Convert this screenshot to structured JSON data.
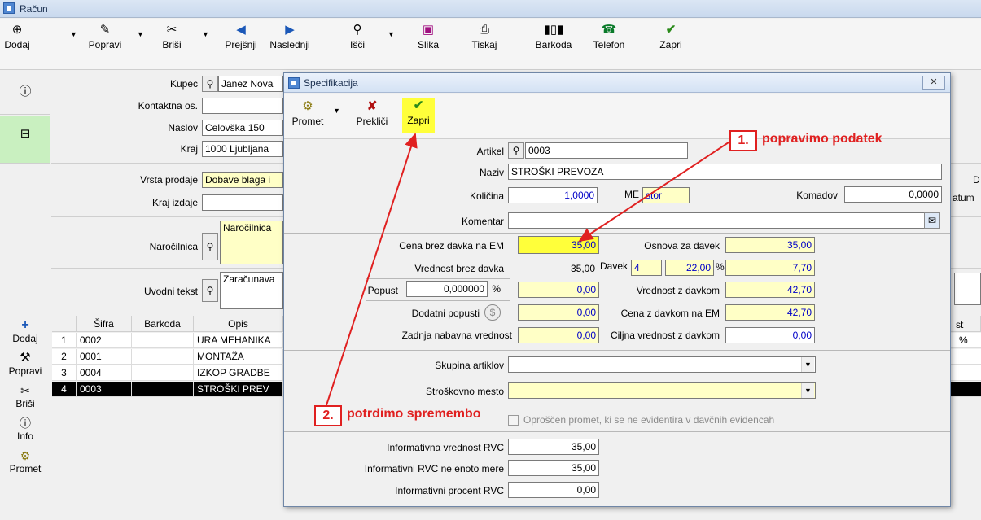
{
  "window": {
    "title": "Račun"
  },
  "toolbar": {
    "items": [
      "Dodaj",
      "Popravi",
      "Briši",
      "Prejšnji",
      "Naslednji",
      "Išči",
      "Slika",
      "Tiskaj",
      "Barkoda",
      "Telefon",
      "Zapri"
    ]
  },
  "sidebar": {
    "buttons": [
      "Dodaj",
      "Popravi",
      "Briši",
      "Info",
      "Promet"
    ]
  },
  "form": {
    "kupec_label": "Kupec",
    "kupec": "Janez Nova",
    "kontakt_label": "Kontaktna os.",
    "kontakt": "",
    "naslov_label": "Naslov",
    "naslov": "Celovška 150",
    "kraj_label": "Kraj",
    "kraj": "1000 Ljubljana",
    "vrsta_label": "Vrsta prodaje",
    "vrsta": "Dobave blaga i",
    "krajizd_label": "Kraj izdaje",
    "krajizd": "",
    "narocilnica_label": "Naročilnica",
    "narocilnica": "Naročilnica",
    "uvodni_label": "Uvodni tekst",
    "uvodni": "Zaračunava",
    "right_d": "D",
    "right_datum": "atum",
    "right_st": "st",
    "right_pct": "%"
  },
  "grid": {
    "headers": [
      "Šifra",
      "Barkoda",
      "Opis"
    ],
    "rows": [
      {
        "n": "1",
        "sifra": "0002",
        "opis": "URA MEHANIKA"
      },
      {
        "n": "2",
        "sifra": "0001",
        "opis": "MONTAŽA"
      },
      {
        "n": "3",
        "sifra": "0004",
        "opis": "IZKOP GRADBE"
      },
      {
        "n": "4",
        "sifra": "0003",
        "opis": "STROŠKI PREV"
      }
    ]
  },
  "dialog": {
    "title": "Specifikacija",
    "toolbar": [
      "Promet",
      "Prekliči",
      "Zapri"
    ],
    "artikel_label": "Artikel",
    "artikel": "0003",
    "naziv_label": "Naziv",
    "naziv": "STROŠKI PREVOZA",
    "kolicina_label": "Količina",
    "kolicina": "1,0000",
    "me_label": "ME",
    "me": "stor",
    "komadov_label": "Komadov",
    "komadov": "0,0000",
    "komentar_label": "Komentar",
    "komentar": "",
    "cena_label": "Cena brez davka na EM",
    "cena": "35,00",
    "osnova_label": "Osnova za davek",
    "osnova": "35,00",
    "vrednost_label": "Vrednost brez davka",
    "vrednost": "35,00",
    "davek_label": "Davek",
    "davek_code": "4",
    "davek_rate": "22,00",
    "pct": "%",
    "davek_val": "7,70",
    "popust_label": "Popust",
    "popust": "0,000000",
    "popust_val": "0,00",
    "vrednostz_label": "Vrednost z davkom",
    "vrednostz": "42,70",
    "dodatni_label": "Dodatni popusti",
    "dodatni": "0,00",
    "cenaz_label": "Cena z davkom na EM",
    "cenaz": "42,70",
    "zadnja_label": "Zadnja nabavna vrednost",
    "zadnja": "0,00",
    "ciljna_label": "Ciljna vrednost z davkom",
    "ciljna": "0,00",
    "skupina_label": "Skupina artiklov",
    "skupina": "",
    "strosek_label": "Stroškovno mesto",
    "strosek": "",
    "oproscen_label": "Oproščen promet, ki se ne evidentira v davčnih evidencah",
    "info_rvc_label": "Informativna vrednost RVC",
    "info_rvc": "35,00",
    "info_rvc_ne_label": "Informativni RVC ne enoto mere",
    "info_rvc_ne": "35,00",
    "info_proc_label": "Informativni procent RVC",
    "info_proc": "0,00"
  },
  "annotations": {
    "n1": "1.",
    "t1": "popravimo podatek",
    "n2": "2.",
    "t2": "potrdimo spremembo"
  },
  "colors": {
    "highlight": "#ffff3a",
    "annotation": "#e02020",
    "field_yellow": "#ffffc6",
    "number_blue": "#0000c8"
  }
}
